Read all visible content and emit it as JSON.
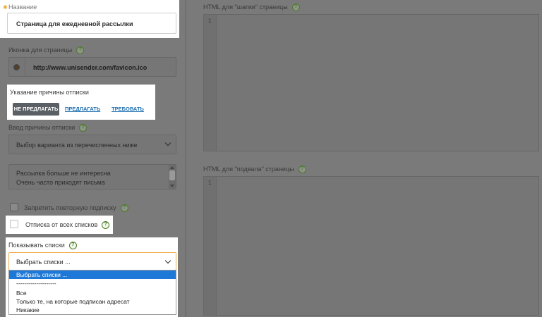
{
  "form": {
    "name": {
      "label": "Название",
      "value": "Страница для ежедневной рассылки"
    },
    "icon": {
      "label": "Иконка для страницы",
      "value": "http://www.unisender.com/favicon.ico"
    },
    "reason": {
      "label": "Указание причины отписки",
      "options": [
        "НЕ ПРЕДЛАГАТЬ",
        "ПРЕДЛАГАТЬ",
        "ТРЕБОВАТЬ"
      ],
      "selected_index": 0
    },
    "reason_entry": {
      "label": "Ввод причины отписки",
      "value": "Выбор варианта из перечисленных ниже"
    },
    "reasons_list": [
      "Рассылка больше не интересна",
      "Очень часто приходят письма"
    ],
    "ban_resubscribe": {
      "label": "Запретить повторную подписку",
      "checked": false
    },
    "unsubscribe_all": {
      "label": "Отписка от всех списков",
      "checked": false
    },
    "show_lists": {
      "label": "Показывать списки",
      "value": "Выбрать списки ...",
      "options": [
        "Выбрать списки ...",
        "--------------------",
        "Все",
        "Только те, на которые подписан адресат",
        "Никакие"
      ],
      "selected_index": 0
    }
  },
  "editors": {
    "header": {
      "title": "HTML для \"шапки\" страницы",
      "line": "1"
    },
    "footer": {
      "title": "HTML для \"подвала\" страницы",
      "line": "1"
    }
  },
  "help_glyph": "?",
  "colors": {
    "link": "#1e6fb3",
    "selected_option": "#1e78d7",
    "focus_border": "#f0ad4e",
    "help": "#4a7a2a"
  }
}
